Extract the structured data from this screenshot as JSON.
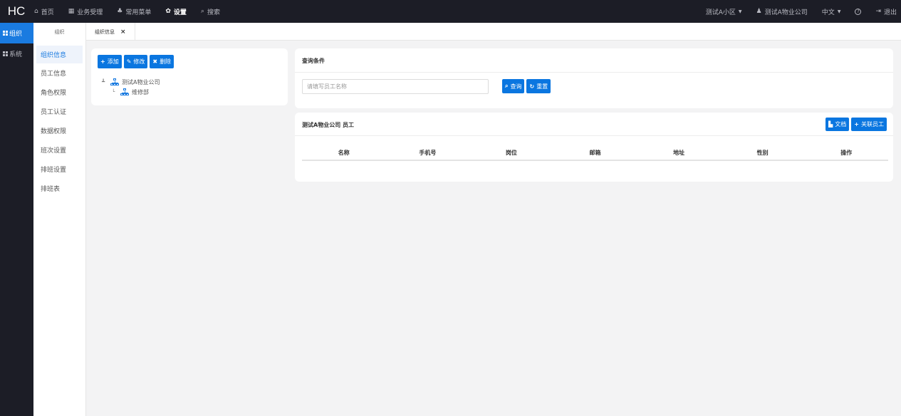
{
  "brand": "HC",
  "topnav": [
    {
      "icon": "home-icon",
      "glyph": "⌂",
      "label": "首页"
    },
    {
      "icon": "calculator-icon",
      "glyph": "▦",
      "label": "业务受理"
    },
    {
      "icon": "sitemap-icon",
      "glyph": "♣",
      "label": "常用菜单"
    },
    {
      "icon": "gear-icon",
      "glyph": "✿",
      "label": "设置"
    },
    {
      "icon": "search-icon",
      "glyph": "⌕",
      "label": "搜索"
    }
  ],
  "topright": {
    "community": "测试A小区",
    "company": "测试A物业公司",
    "language": "中文",
    "logout": "退出"
  },
  "side1": [
    {
      "label": "组织"
    },
    {
      "label": "系统"
    }
  ],
  "side2": {
    "header": "组织",
    "items": [
      "组织信息",
      "员工信息",
      "角色权限",
      "员工认证",
      "数据权限",
      "班次设置",
      "排班设置",
      "排班表"
    ]
  },
  "tab": {
    "label": "组织信息",
    "close": "×"
  },
  "org_panel": {
    "add": "添加",
    "edit": "修改",
    "delete": "删除",
    "tree": [
      "测试A物业公司",
      "维修部"
    ]
  },
  "query_panel": {
    "title": "查询条件",
    "placeholder": "请填写员工名称",
    "search": "查询",
    "reset": "重置"
  },
  "staff_panel": {
    "title": "测试A物业公司 员工",
    "doc": "文档",
    "link": "关联员工",
    "columns": [
      "名称",
      "手机号",
      "岗位",
      "邮箱",
      "地址",
      "性别",
      "操作"
    ]
  },
  "colors": {
    "accent": "#0a76e0",
    "nav_bg": "#1c1d26"
  }
}
